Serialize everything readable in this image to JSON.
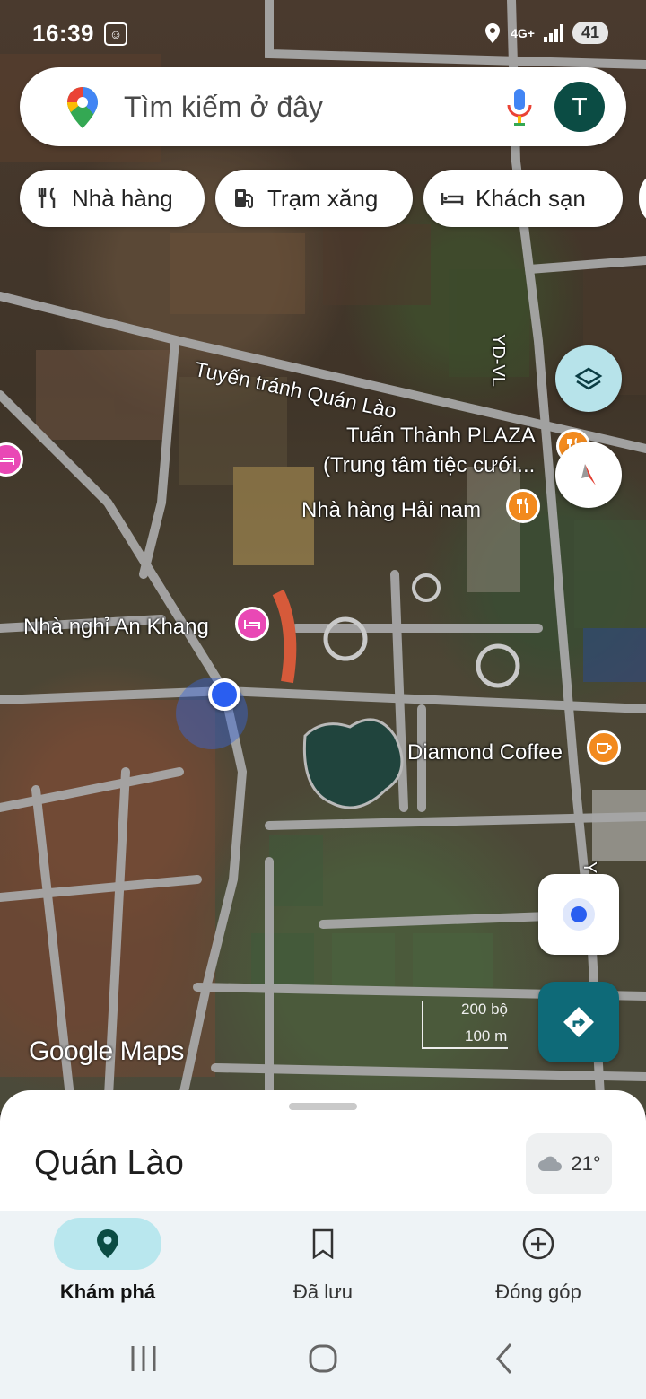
{
  "status_bar": {
    "time": "16:39",
    "network": "4G+",
    "battery": "41"
  },
  "search": {
    "placeholder": "Tìm kiếm ở đây",
    "avatar_letter": "T"
  },
  "chips": [
    {
      "label": "Nhà hàng",
      "icon": "restaurant-icon"
    },
    {
      "label": "Trạm xăng",
      "icon": "gas-station-icon"
    },
    {
      "label": "Khách sạn",
      "icon": "hotel-icon"
    }
  ],
  "map": {
    "road_tuyen_tranh": "Tuyến tránh Quán Lào",
    "road_yd_vl": "YD-VL",
    "road_y": "Y",
    "poi_plaza_line1": "Tuấn Thành PLAZA",
    "poi_plaza_line2": "(Trung tâm tiệc cưới...",
    "poi_hai_nam": "Nhà hàng Hải nam",
    "poi_an_khang": "Nhà nghỉ An Khang",
    "poi_diamond": "Diamond Coffee",
    "watermark": "Google Maps",
    "scale_ft": "200 bộ",
    "scale_m": "100 m"
  },
  "sheet": {
    "place_name": "Quán Lào",
    "temperature": "21°"
  },
  "bottom_nav": [
    {
      "label": "Khám phá",
      "active": true
    },
    {
      "label": "Đã lưu",
      "active": false
    },
    {
      "label": "Đóng góp",
      "active": false
    }
  ],
  "colors": {
    "accent_teal": "#0e6a78",
    "active_tab_bg": "#b9e7ee",
    "hotel_pin": "#e948b5",
    "food_pin": "#f28a1e"
  }
}
